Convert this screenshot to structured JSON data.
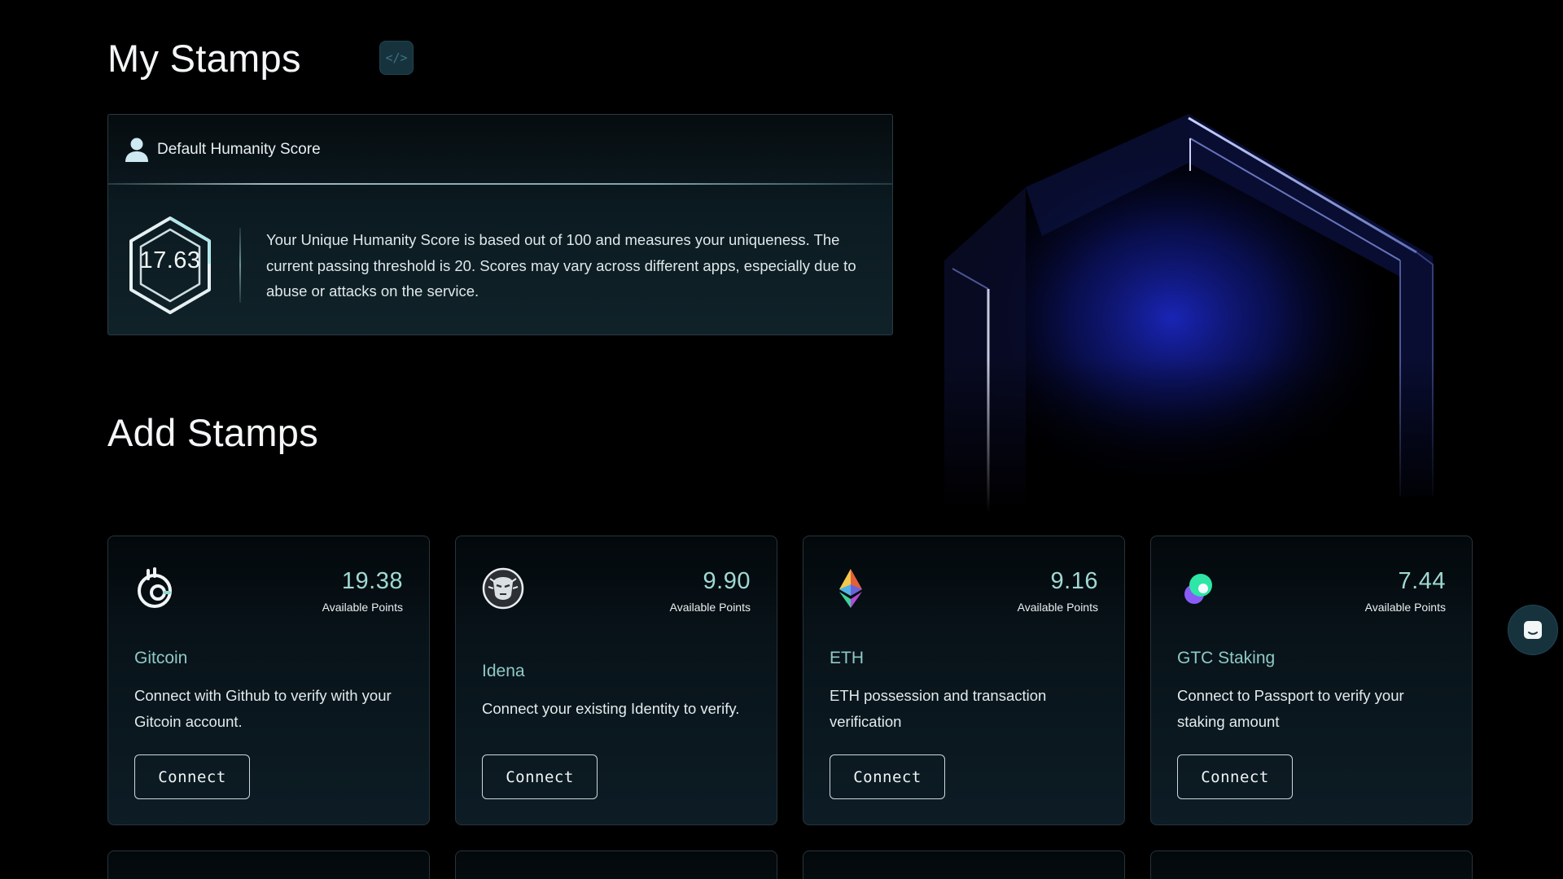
{
  "header": {
    "my_stamps_title": "My Stamps",
    "dev_toggle_icon": "code-icon",
    "dev_toggle_glyph": "</>"
  },
  "score_card": {
    "title": "Default Humanity Score",
    "title_icon": "user-icon",
    "score": "17.63",
    "description": "Your Unique Humanity Score is based out of 100 and measures your uniqueness. The current passing threshold is 20. Scores may vary across different apps, especially due to abuse or attacks on the service."
  },
  "add_stamps": {
    "title": "Add Stamps",
    "points_label": "Available Points",
    "cards": [
      {
        "icon": "gitcoin-logo-icon",
        "points": "19.38",
        "name": "Gitcoin",
        "description": "Connect with Github to verify with your Gitcoin account.",
        "button": "Connect"
      },
      {
        "icon": "idena-logo-icon",
        "points": "9.90",
        "name": "Idena",
        "description": "Connect your existing Identity to verify.",
        "button": "Connect"
      },
      {
        "icon": "ethereum-logo-icon",
        "points": "9.16",
        "name": "ETH",
        "description": "ETH possession and transaction verification",
        "button": "Connect"
      },
      {
        "icon": "gtc-staking-logo-icon",
        "points": "7.44",
        "name": "GTC Staking",
        "description": "Connect to Passport to verify your staking amount",
        "button": "Connect"
      }
    ]
  },
  "chat": {
    "icon": "chat-icon"
  },
  "colors": {
    "background": "#000000",
    "accent_teal": "#9fd9d3",
    "stamp_name": "#8fc9c6",
    "card_border": "#27343b",
    "dev_toggle_bg": "#16323d",
    "hero_glow_blue": "#1e2bd6"
  }
}
